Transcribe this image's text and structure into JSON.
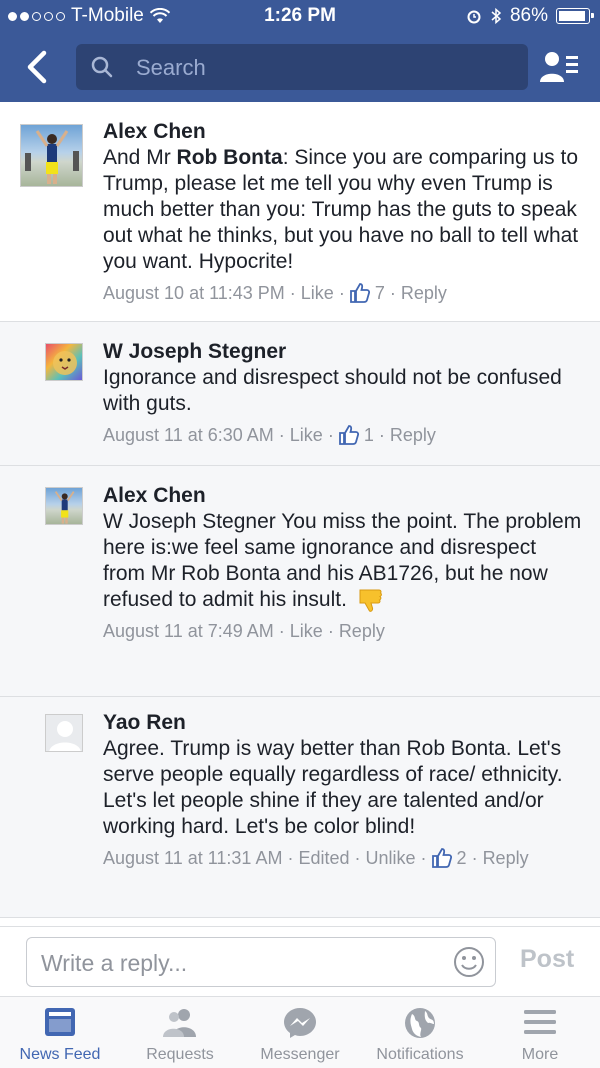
{
  "status_bar": {
    "carrier": "T-Mobile",
    "time": "1:26 PM",
    "battery": "86%"
  },
  "nav": {
    "search_placeholder": "Search"
  },
  "comments": [
    {
      "author": "Alex Chen",
      "text_pre": "And Mr ",
      "text_bold": "Rob Bonta",
      "text_post": ": Since you are comparing us to Trump, please let me tell you why even Trump is much better than you: Trump has the guts to speak out what he thinks, but you have no ball to tell what you want. Hypocrite!",
      "time": "August 10 at 11:43 PM",
      "like": "Like",
      "like_count": "7",
      "reply": "Reply"
    },
    {
      "author": "W Joseph Stegner",
      "text": "Ignorance and disrespect should not be confused with guts.",
      "time": "August 11 at 6:30 AM",
      "like": "Like",
      "like_count": "1",
      "reply": "Reply"
    },
    {
      "author": "Alex Chen",
      "text": "W Joseph Stegner You miss the point. The problem here is:we feel same ignorance and disrespect from Mr Rob Bonta and his AB1726, but he now refused to admit his insult.",
      "emoji": "thumbs-down-emoji",
      "time": "August 11 at 7:49 AM",
      "like": "Like",
      "reply": "Reply"
    },
    {
      "author": "Yao Ren",
      "text": "Agree. Trump is way better than Rob Bonta. Let's serve people equally regardless of race/ ethnicity. Let's let people shine if they are talented and/or working hard. Let's be color blind!",
      "time": "August 11 at 11:31 AM",
      "edited": "Edited",
      "unlike": "Unlike",
      "like_count": "2",
      "reply": "Reply"
    }
  ],
  "composer": {
    "placeholder": "Write a reply...",
    "post_label": "Post"
  },
  "tabs": [
    {
      "label": "News Feed",
      "icon": "news-feed-icon"
    },
    {
      "label": "Requests",
      "icon": "requests-icon"
    },
    {
      "label": "Messenger",
      "icon": "messenger-icon"
    },
    {
      "label": "Notifications",
      "icon": "globe-icon"
    },
    {
      "label": "More",
      "icon": "menu-icon"
    }
  ],
  "colors": {
    "brand": "#3b5998",
    "active_tab": "#4267b2",
    "meta_text": "#90949c"
  }
}
